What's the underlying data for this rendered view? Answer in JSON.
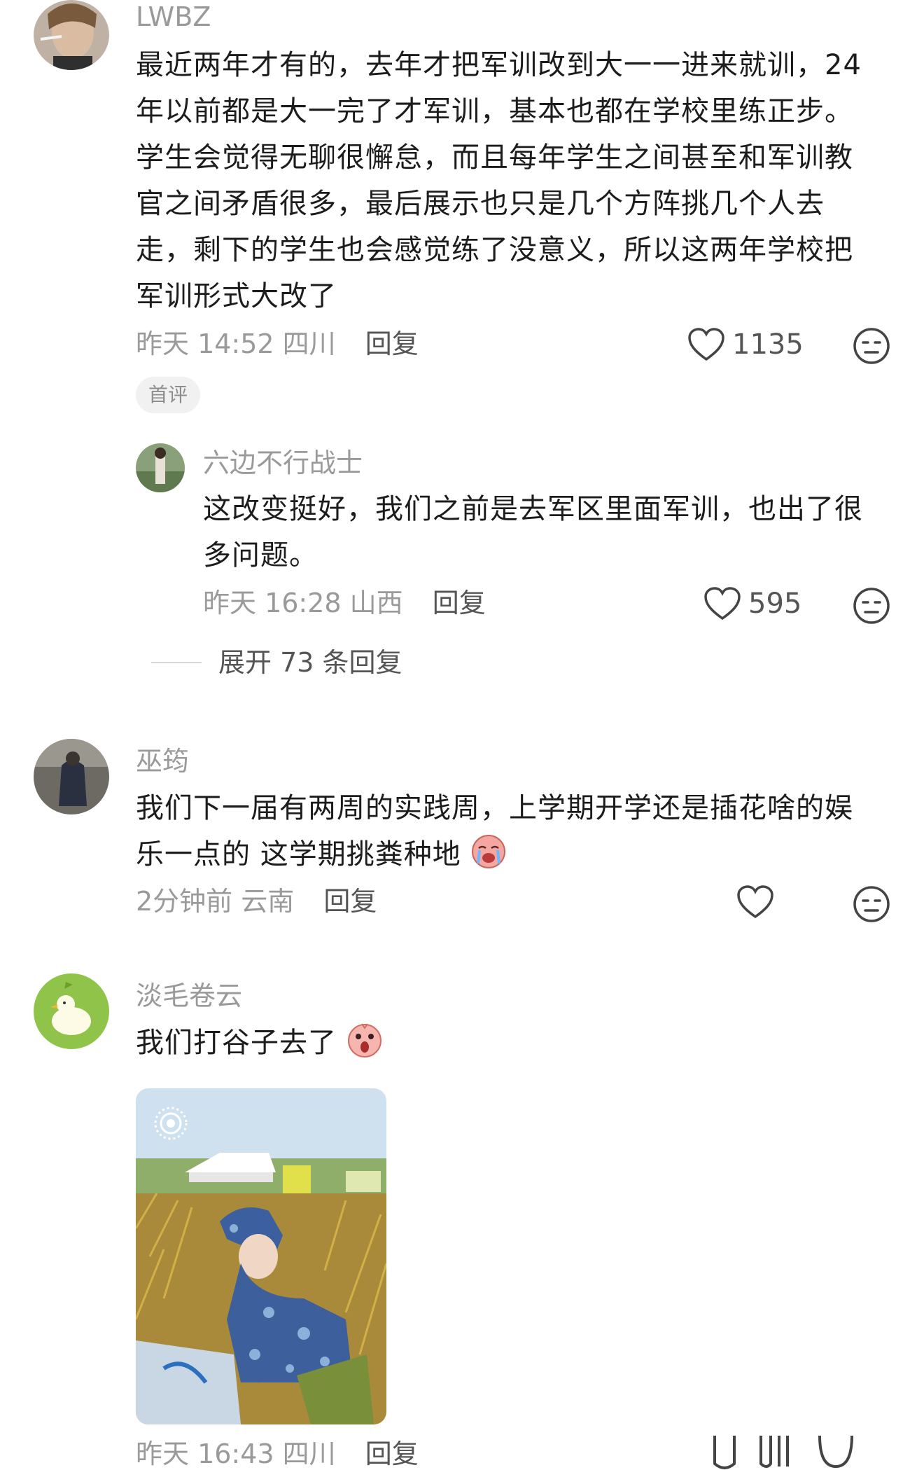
{
  "comments": [
    {
      "username": "LWBZ",
      "lines": [
        "最近两年才有的，去年才把军训改到大一一进来就训，24",
        "年以前都是大一完了才军训，基本也都在学校里练正步。",
        "学生会觉得无聊很懈怠，而且每年学生之间甚至和军训教",
        "官之间矛盾很多，最后展示也只是几个方阵挑几个人去",
        "走，剩下的学生也会感觉练了没意义，所以这两年学校把",
        "军训形式大改了"
      ],
      "time": "昨天 14:52 四川",
      "reply": "回复",
      "likes": "1135",
      "badge": "首评"
    },
    {
      "username": "六边不行战士",
      "lines": [
        "这改变挺好，我们之前是去军区里面军训，也出了很",
        "多问题。"
      ],
      "time": "昨天 16:28 山西",
      "reply": "回复",
      "likes": "595"
    },
    {
      "expand": "展开 73 条回复"
    },
    {
      "username": "巫筠",
      "lines": [
        "我们下一届有两周的实践周，上学期开学还是插花啥的娱",
        "乐一点的 这学期挑粪种地"
      ],
      "time": "2分钟前 云南",
      "reply": "回复",
      "likes": ""
    },
    {
      "username": "淡毛卷云",
      "lines": [
        "我们打谷子去了"
      ],
      "time": "昨天 16:43 四川",
      "reply": "回复"
    }
  ],
  "icons": {
    "like": "heart-outline-icon",
    "dislike": "neutral-face-icon",
    "emoji_cry": "crying-face-emoji",
    "emoji_shock": "shocked-face-emoji",
    "live": "live-photo-icon"
  },
  "colors": {
    "username": "#9a9a9a",
    "text": "#1c1c1c",
    "meta": "#9a9a9a",
    "badge_bg": "#f1f1f1"
  }
}
